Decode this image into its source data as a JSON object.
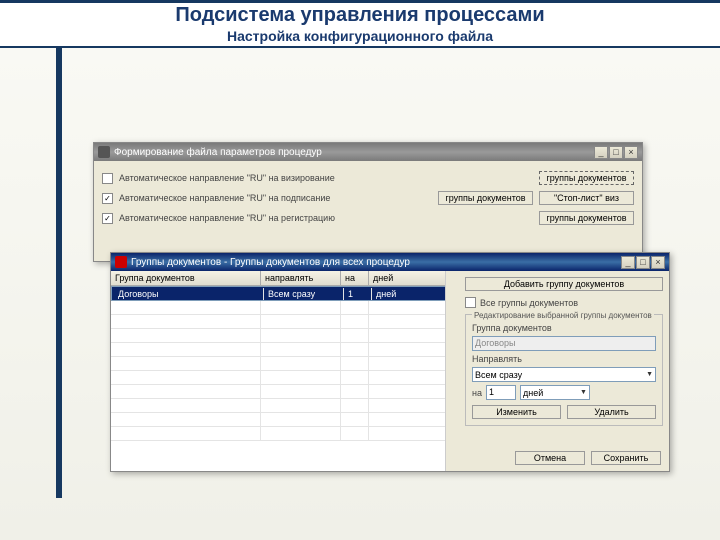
{
  "header": {
    "title": "Подсистема управления процессами",
    "subtitle": "Настройка конфигурационного файла"
  },
  "win1": {
    "title": "Формирование файла параметров процедур",
    "rows": [
      {
        "checked": false,
        "label": "Автоматическое направление \"RU\" на визирование",
        "btn": "группы документов",
        "dotted": true
      },
      {
        "checked": true,
        "label": "Автоматическое направление \"RU\" на подписание",
        "btn": "группы документов",
        "extra": "\"Стоп-лист\" виз"
      },
      {
        "checked": true,
        "label": "Автоматическое направление \"RU\" на регистрацию",
        "btn": "группы документов"
      }
    ]
  },
  "win2": {
    "title": "Группы документов - Группы документов для всех процедур",
    "columns": {
      "c1": "Группа документов",
      "c2": "направлять",
      "c3": "на",
      "c4": "дней"
    },
    "row": {
      "c1": "Договоры",
      "c2": "Всем сразу",
      "c3": "1",
      "c4": "дней"
    },
    "addBtn": "Добавить группу документов",
    "allGroups": "Все группы документов",
    "fieldsetTitle": "Редактирование выбранной группы документов",
    "groupLabel": "Группа документов",
    "groupValue": "Договоры",
    "sendLabel": "Направлять",
    "sendValue": "Всем сразу",
    "onLabel": "на",
    "onValue": "1",
    "unit": "дней",
    "editBtn": "Изменить",
    "deleteBtn": "Удалить",
    "cancelBtn": "Отмена",
    "saveBtn": "Сохранить"
  },
  "winBtns": {
    "min": "_",
    "max": "□",
    "close": "×"
  }
}
